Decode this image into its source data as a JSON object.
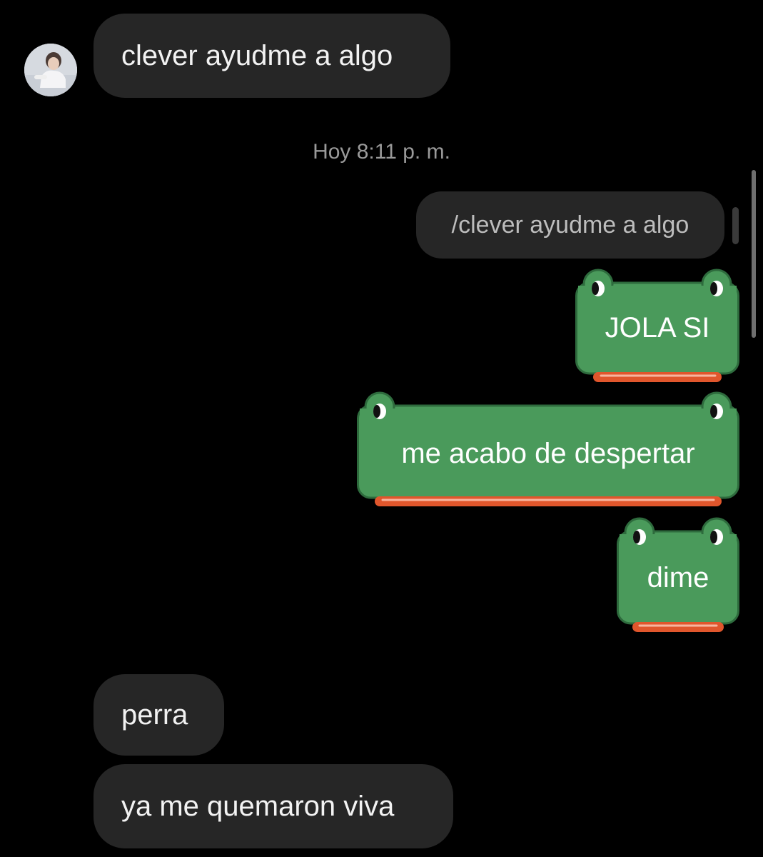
{
  "conversation": {
    "incoming_first": "clever ayudme a algo",
    "timestamp": "Hoy 8:11 p. m.",
    "reply_quote": "/clever ayudme a algo",
    "outgoing": [
      {
        "text": "JOLA SI"
      },
      {
        "text": "me acabo de despertar"
      },
      {
        "text": "dime"
      }
    ],
    "incoming_last": [
      {
        "text": "perra"
      },
      {
        "text": "ya me quemaron viva"
      }
    ]
  },
  "colors": {
    "background": "#000000",
    "incoming_bubble": "#262626",
    "frog_green": "#4a9a5b",
    "frog_outline": "#2e6b3d",
    "frog_mouth": "#e0562c",
    "timestamp_text": "#9a9a9a"
  },
  "icons": {
    "avatar": "profile-photo-avatar",
    "bubble_style": "frog-sticker-bubble"
  }
}
